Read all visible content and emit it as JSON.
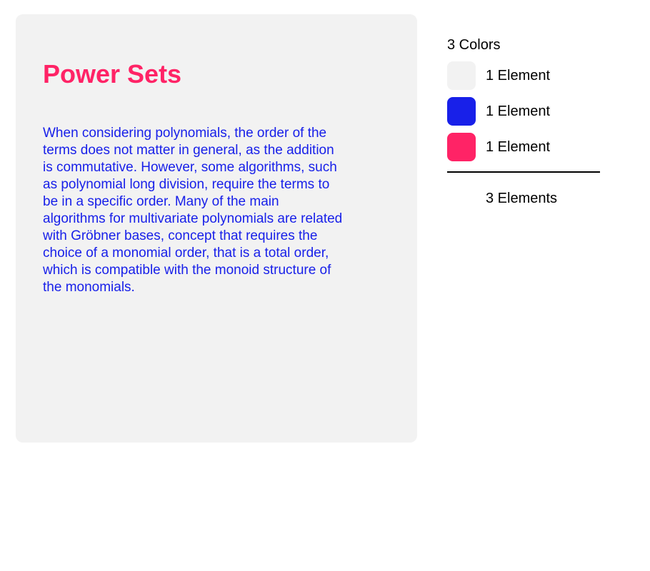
{
  "card": {
    "title": "Power Sets",
    "body": "When considering polynomials, the order of the terms does not matter in general, as the addition is commutative. However, some algorithms, such as polynomial long division, require the terms to be in a specific order. Many of the main algorithms for multivariate polynomials are related with Gröbner bases, concept that requires the choice of a monomial order, that is a total order, which is compatible with the monoid structure of the monomials.",
    "colors": {
      "background": "#f2f2f2",
      "title": "#ff2366",
      "body": "#1820e9"
    }
  },
  "legend": {
    "heading": "3 Colors",
    "items": [
      {
        "color": "#f2f2f2",
        "label": "1 Element"
      },
      {
        "color": "#1820e9",
        "label": "1 Element"
      },
      {
        "color": "#ff2366",
        "label": "1 Element"
      }
    ],
    "total": "3 Elements"
  }
}
